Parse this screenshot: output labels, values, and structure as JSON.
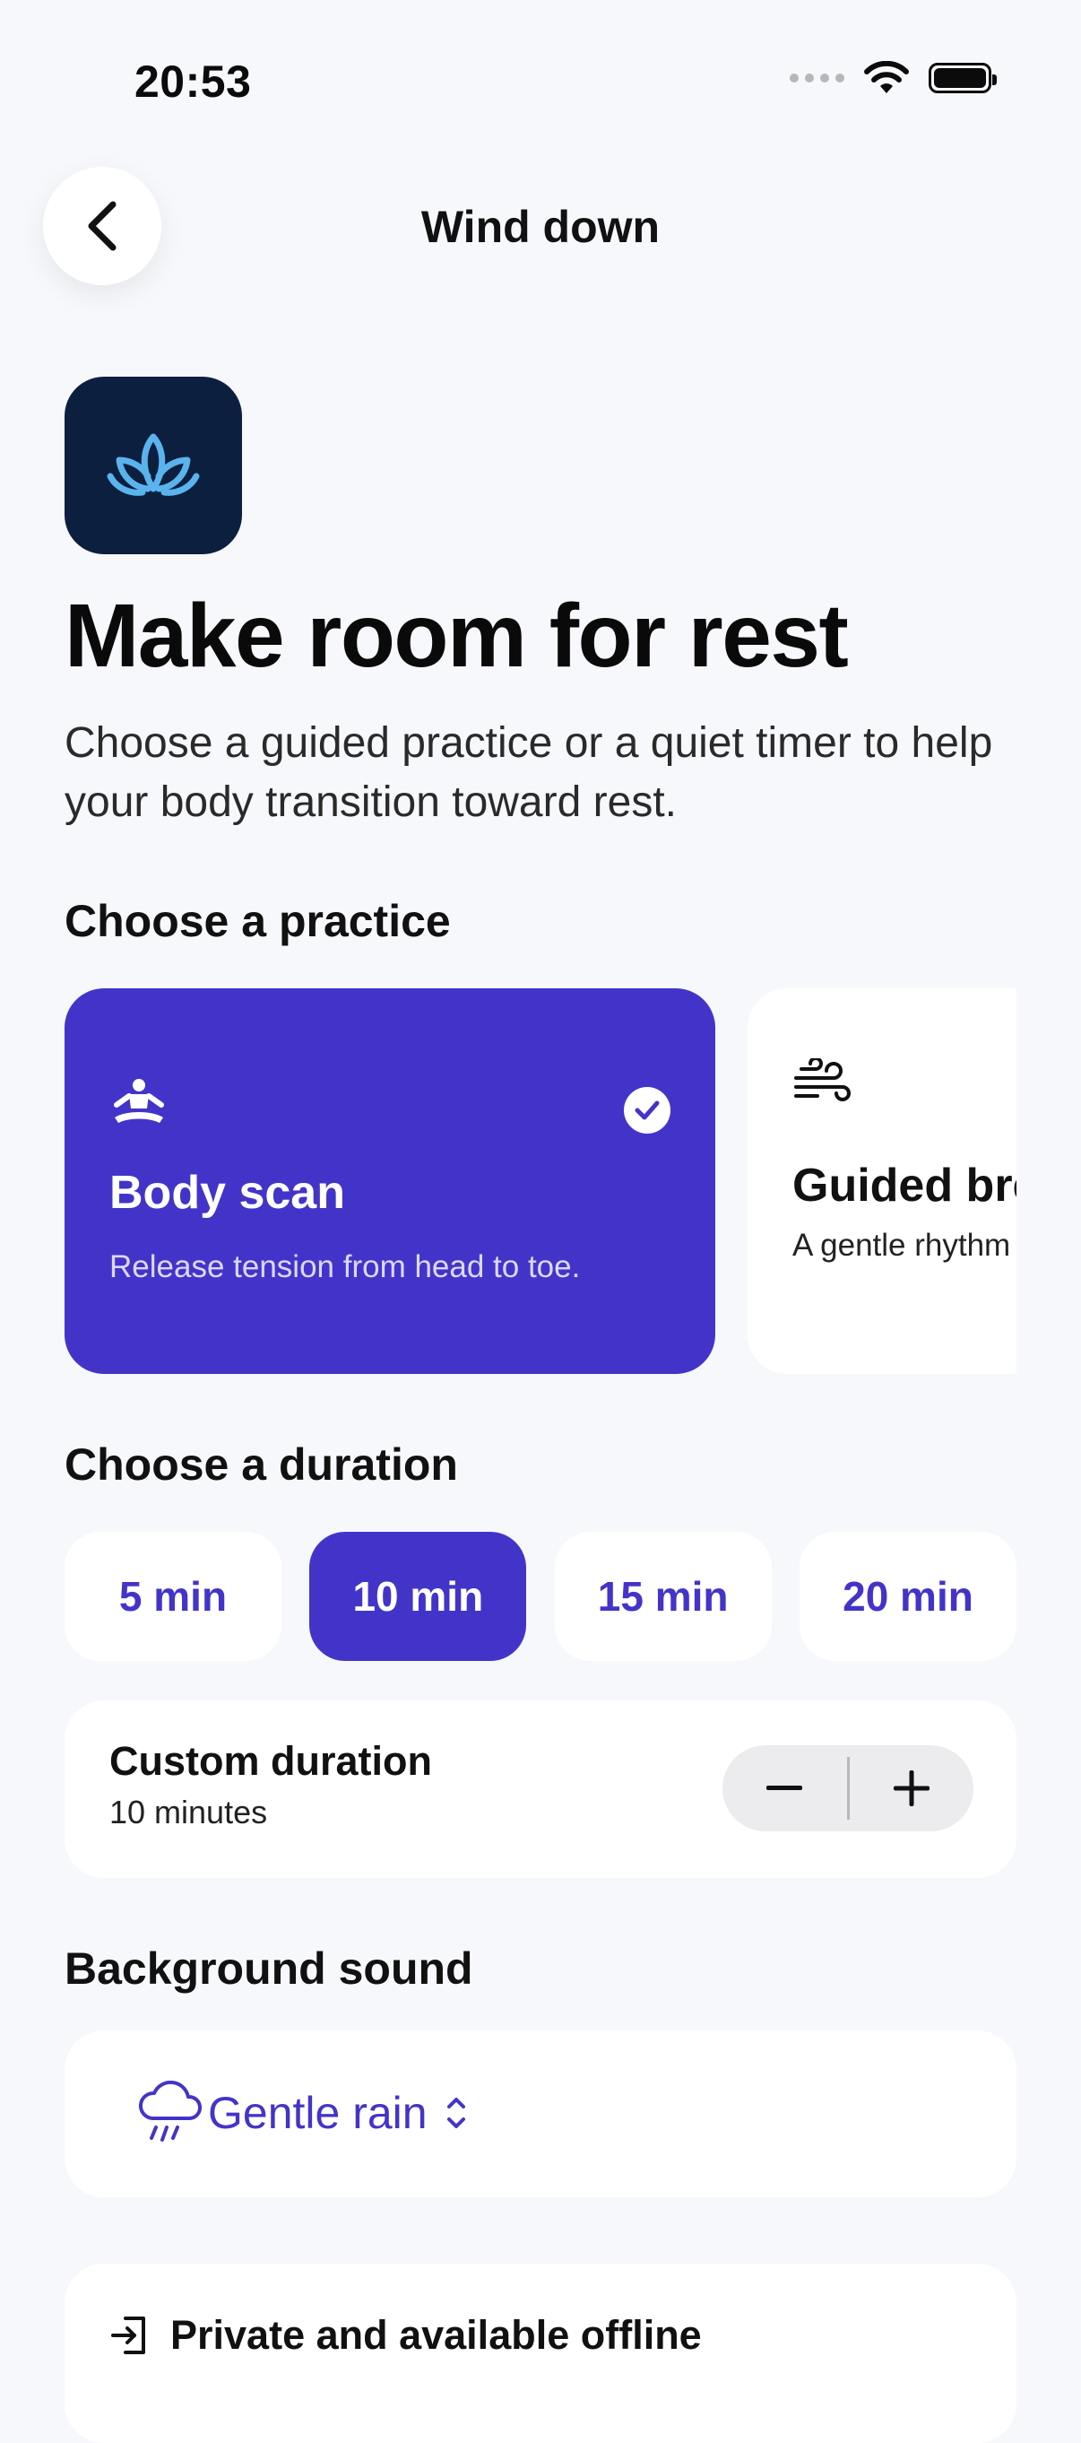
{
  "status_bar": {
    "time": "20:53"
  },
  "nav": {
    "title": "Wind down",
    "back_icon": "chevron-left-icon"
  },
  "header": {
    "icon": "lotus-icon",
    "icon_bg": "#0c1f3f",
    "icon_color": "#5ab3ec",
    "title": "Make room for rest",
    "subtitle": "Choose a guided practice or a quiet timer to help your body transition toward rest."
  },
  "practice": {
    "section_title": "Choose a practice",
    "cards": [
      {
        "icon": "meditation-person-icon",
        "title": "Body scan",
        "description": "Release tension from head to toe.",
        "selected": true
      },
      {
        "icon": "wind-icon",
        "title": "Guided breathing",
        "description": "A gentle rhythm for settling attention.",
        "selected": false
      }
    ]
  },
  "duration": {
    "section_title": "Choose a duration",
    "options": [
      "5 min",
      "10 min",
      "15 min",
      "20 min"
    ],
    "selected": "10 min",
    "custom": {
      "title": "Custom duration",
      "value": "10 minutes"
    }
  },
  "sound": {
    "section_title": "Background sound",
    "icon": "cloud-rain-icon",
    "selected": "Gentle rain"
  },
  "privacy": {
    "icon": "door-arrow-icon",
    "label": "Private and available offline"
  },
  "colors": {
    "accent": "#4334c9",
    "background": "#f7f8fc",
    "card": "#ffffff"
  }
}
